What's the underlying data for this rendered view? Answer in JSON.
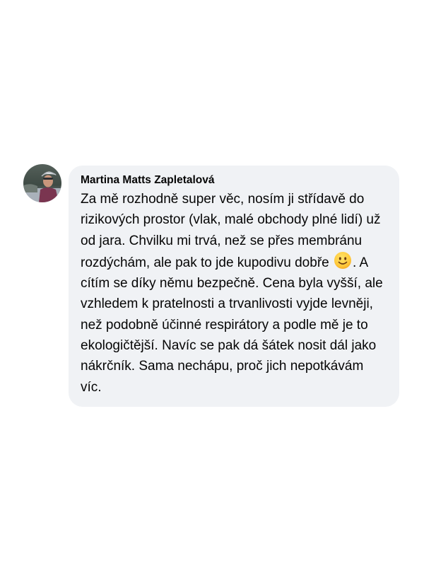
{
  "comment": {
    "author": "Martina Matts Zapletalová",
    "text_before_emoji": "Za mě rozhodně super věc, nosím ji střídavě do rizikových prostor (vlak, malé obchody plné lidí) už od jara. Chvilku mi trvá, než se přes membránu rozdýchám, ale pak to jde kupodivu dobře",
    "emoji": "slightly-smiling-face-icon",
    "text_after_emoji": ". A cítím se díky němu bezpečně. Cena byla vyšší, ale vzhledem k pratelnosti a trvanlivosti vyjde levněji, než podobně účinné respirátory a podle mě je to ekologičtější. Navíc se pak dá šátek nosit dál jako nákrčník. Sama nechápu, proč jich nepotkávám víc."
  }
}
